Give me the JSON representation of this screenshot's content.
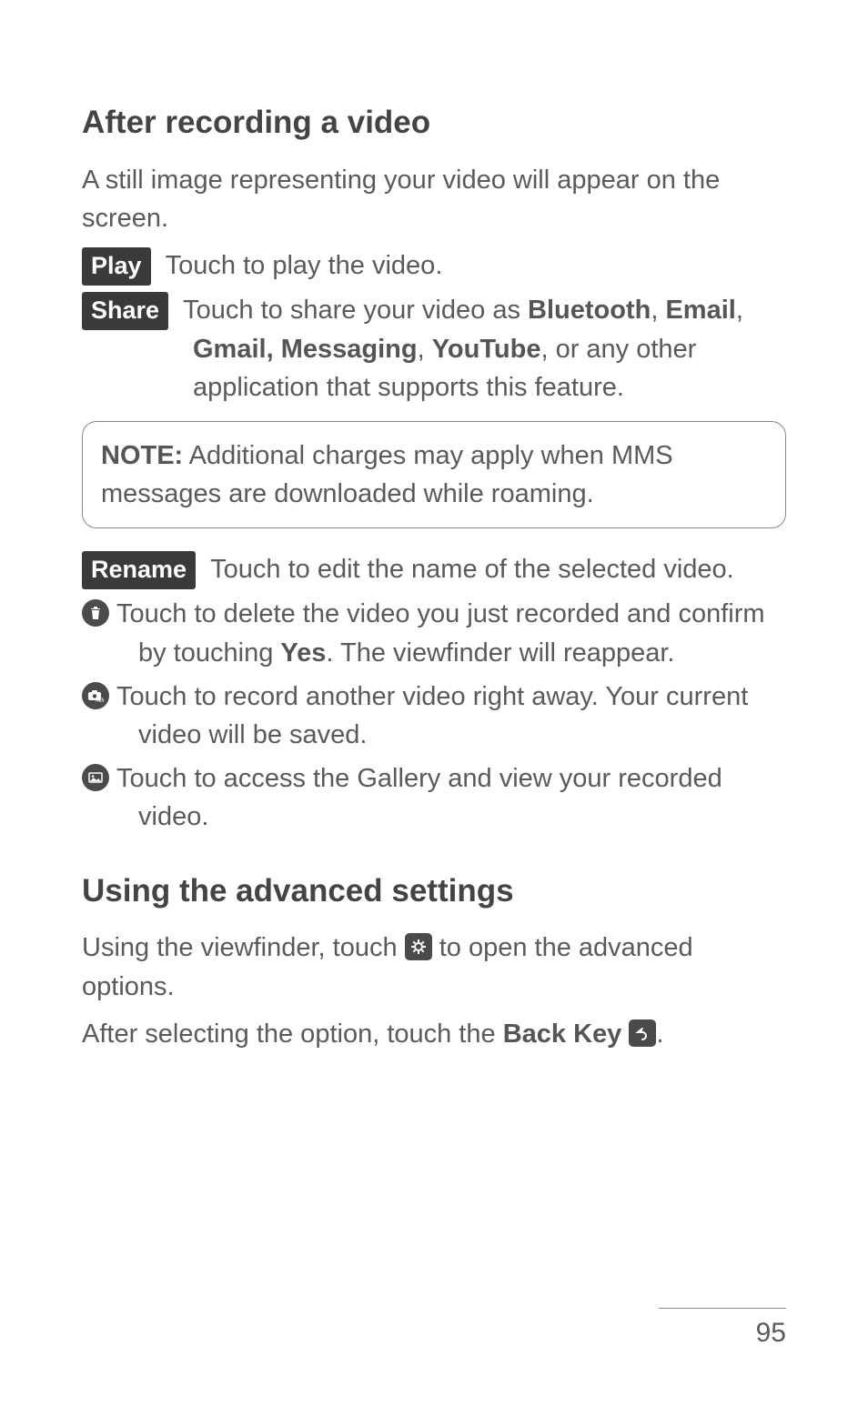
{
  "section1": {
    "heading": "After recording a video",
    "intro": "A still image representing your video will appear on the screen.",
    "play": {
      "badge": "Play",
      "text": "Touch to play the video."
    },
    "share": {
      "badge": "Share",
      "pre": "Touch to share your video as ",
      "b1": "Bluetooth",
      "mid1": ", ",
      "b2": "Email",
      "mid2": ", ",
      "b3": "Gmail, Messaging",
      "mid3": ", ",
      "b4": "YouTube",
      "post": ", or any other application that supports this feature."
    },
    "note": {
      "label": "NOTE:",
      "text": " Additional charges may apply when MMS messages are downloaded while roaming."
    },
    "rename": {
      "badge": "Rename",
      "text": "Touch to edit the name of the selected video."
    },
    "trash": {
      "pre": "Touch to delete the video you just recorded and confirm by touching ",
      "b": "Yes",
      "post": ". The viewfinder will reappear."
    },
    "newrec": "Touch to record another video right away. Your current video will be saved.",
    "gallery": "Touch to access the Gallery and view your recorded video."
  },
  "section2": {
    "heading": "Using the advanced settings",
    "line1_pre": "Using the viewfinder, touch ",
    "line1_post": " to open the advanced options.",
    "line2_pre": "After selecting the option, touch the ",
    "line2_bold": "Back Key",
    "line2_post": "."
  },
  "pageNumber": "95"
}
